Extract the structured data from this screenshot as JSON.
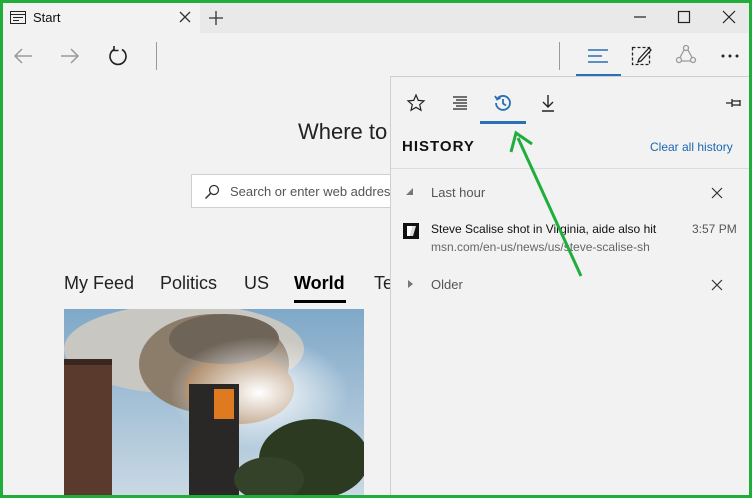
{
  "tab": {
    "title": "Start"
  },
  "page": {
    "heading": "Where to",
    "search_placeholder": "Search or enter web address",
    "feed_tabs": [
      "My Feed",
      "Politics",
      "US",
      "World",
      "Te"
    ]
  },
  "hub": {
    "title": "HISTORY",
    "clear_label": "Clear all history",
    "groups": {
      "last_hour": "Last hour",
      "older": "Older"
    },
    "items": [
      {
        "title": "Steve Scalise shot in Virginia, aide also hit",
        "url": "msn.com/en-us/news/us/steve-scalise-sh",
        "time": "3:57 PM"
      }
    ]
  },
  "colors": {
    "accent": "#2b6fb6",
    "annotation": "#1fae3c"
  }
}
